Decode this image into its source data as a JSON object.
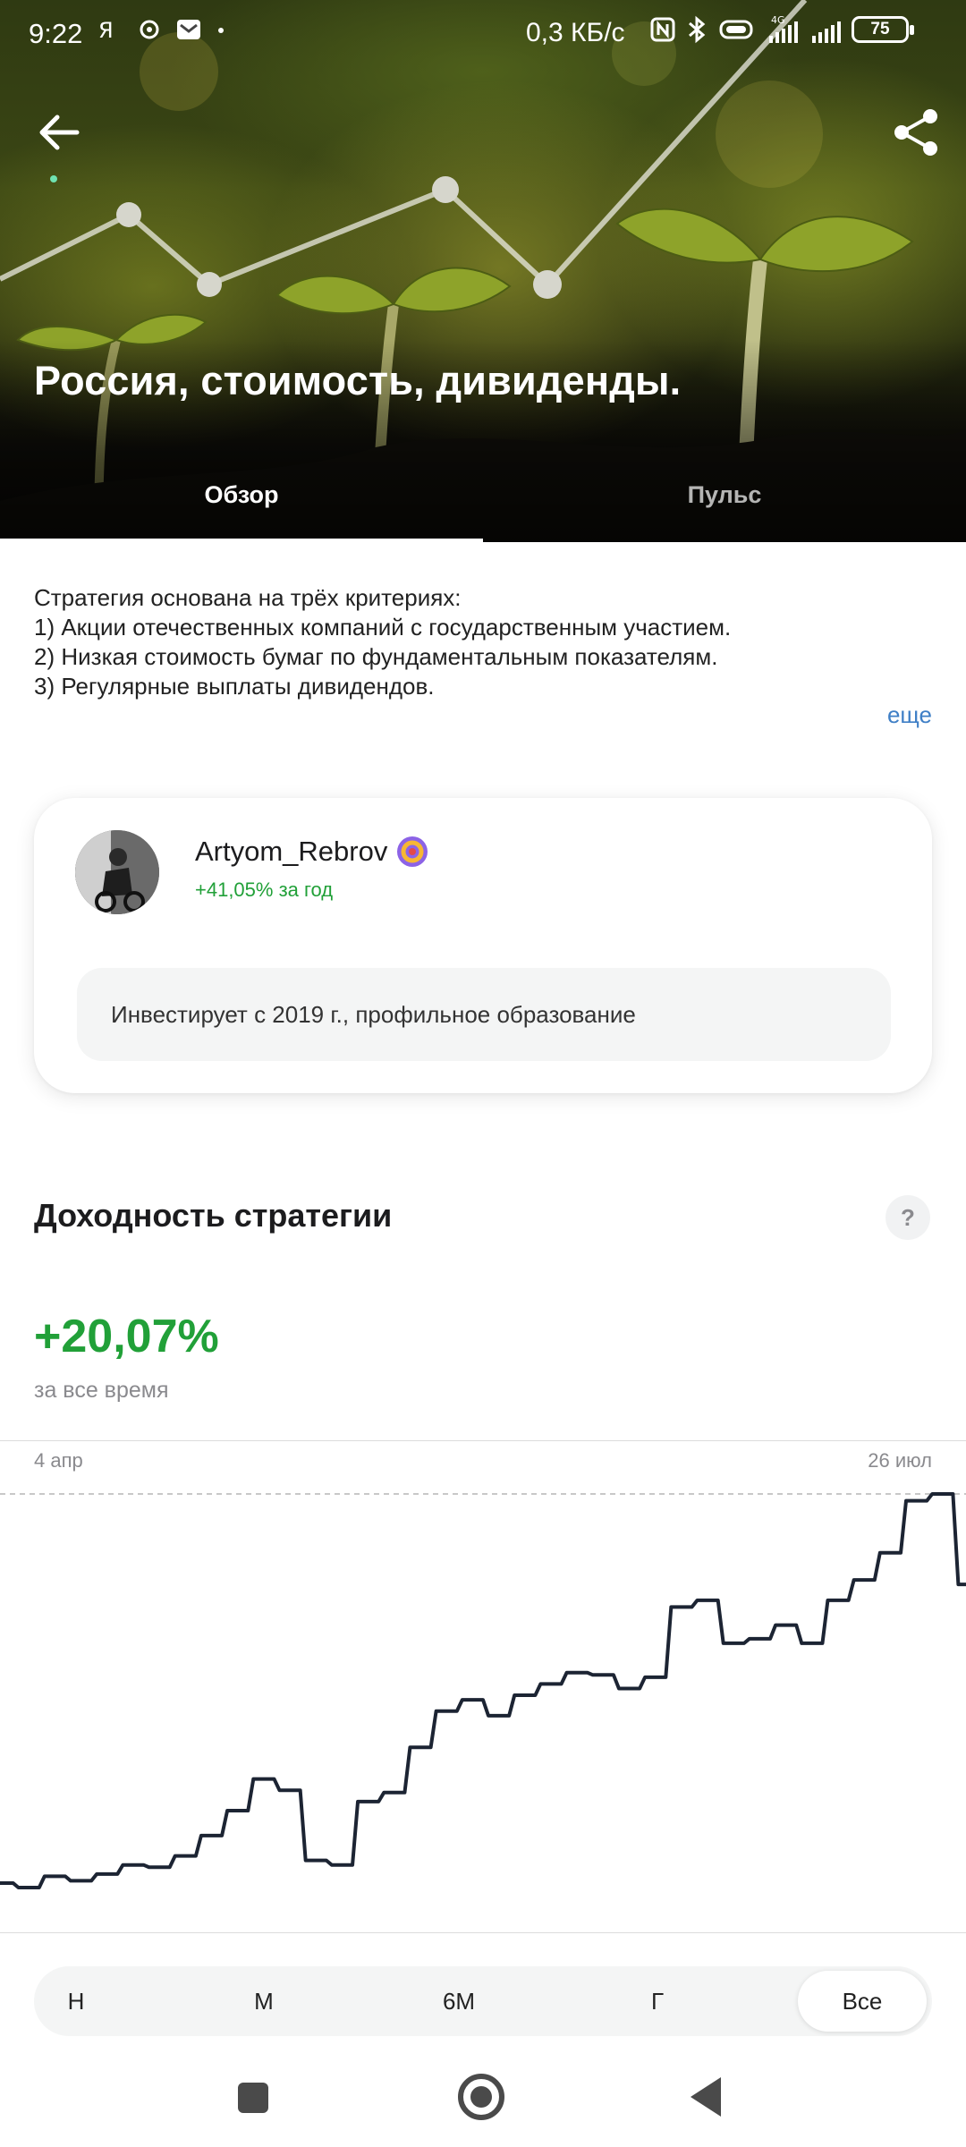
{
  "status_bar": {
    "time": "9:22",
    "speed": "0,3 КБ/с",
    "network_label": "4G",
    "battery": "75",
    "icons": [
      "yandex-icon",
      "settings-icon",
      "mail-icon",
      "dot-icon",
      "nfc-icon",
      "bluetooth-icon",
      "vibrate-icon",
      "signal-icon",
      "signal-icon",
      "battery-icon"
    ]
  },
  "header": {
    "title": "Россия, стоимость, дивиденды.",
    "back_icon": "arrow-left-icon",
    "share_icon": "share-icon"
  },
  "tabs": [
    {
      "label": "Обзор",
      "active": true
    },
    {
      "label": "Пульс",
      "active": false
    }
  ],
  "description": {
    "lines": [
      "Стратегия основана на трёх критериях:",
      "1) Акции отечественных компаний с государственным участием.",
      "2) Низкая стоимость бумаг по фундаментальным показателям.",
      "3) Регулярные выплаты дивидендов."
    ],
    "more_label": "еще"
  },
  "author": {
    "name": "Artyom_Rebrov",
    "yield": "+41,05% за год",
    "bio": "Инвестирует с 2019 г., профильное образование",
    "badge_icon": "verified-badge-icon"
  },
  "performance": {
    "title": "Доходность стратегии",
    "help_label": "?",
    "value": "+20,07%",
    "subtitle": "за все время",
    "start_date": "4 апр",
    "end_date": "26 июл"
  },
  "chart_data": {
    "type": "line",
    "title": "",
    "xlabel": "",
    "ylabel": "",
    "x_range": [
      "4 апр",
      "26 июл"
    ],
    "grid": false,
    "reference_line": "dashed, at maximum",
    "series": [
      {
        "values": [
          0.2,
          0.0,
          0.5,
          0.3,
          0.6,
          1.0,
          0.9,
          1.4,
          2.3,
          3.4,
          4.8,
          4.3,
          1.2,
          1.0,
          3.8,
          4.2,
          6.2,
          7.8,
          8.3,
          7.6,
          8.5,
          9.0,
          9.5,
          9.4,
          8.8,
          9.3,
          12.4,
          12.7,
          10.8,
          11.0,
          11.6,
          10.8,
          12.7,
          13.6,
          14.8,
          17.1,
          17.4,
          13.4
        ]
      }
    ]
  },
  "periods": [
    {
      "label": "Н",
      "active": false
    },
    {
      "label": "М",
      "active": false
    },
    {
      "label": "6М",
      "active": false
    },
    {
      "label": "Г",
      "active": false
    },
    {
      "label": "Все",
      "active": true
    }
  ],
  "colors": {
    "accent_green": "#21a038",
    "link_blue": "#3f7fc6",
    "chart_line": "#1c2433"
  }
}
